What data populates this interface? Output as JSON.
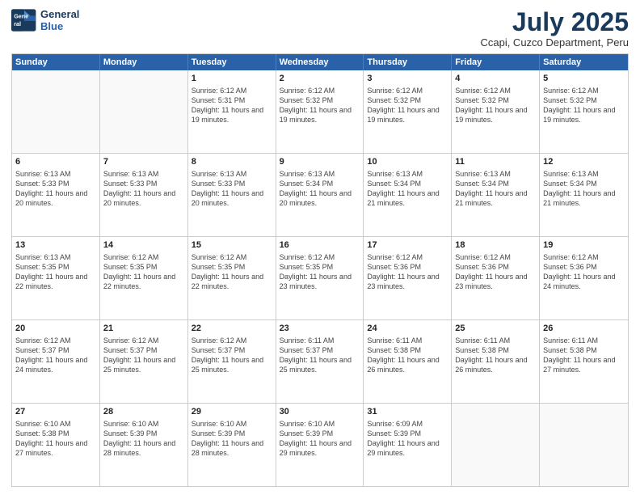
{
  "header": {
    "logo_line1": "General",
    "logo_line2": "Blue",
    "main_title": "July 2025",
    "subtitle": "Ccapi, Cuzco Department, Peru"
  },
  "weekdays": [
    "Sunday",
    "Monday",
    "Tuesday",
    "Wednesday",
    "Thursday",
    "Friday",
    "Saturday"
  ],
  "weeks": [
    [
      {
        "day": "",
        "info": ""
      },
      {
        "day": "",
        "info": ""
      },
      {
        "day": "1",
        "info": "Sunrise: 6:12 AM\nSunset: 5:31 PM\nDaylight: 11 hours and 19 minutes."
      },
      {
        "day": "2",
        "info": "Sunrise: 6:12 AM\nSunset: 5:32 PM\nDaylight: 11 hours and 19 minutes."
      },
      {
        "day": "3",
        "info": "Sunrise: 6:12 AM\nSunset: 5:32 PM\nDaylight: 11 hours and 19 minutes."
      },
      {
        "day": "4",
        "info": "Sunrise: 6:12 AM\nSunset: 5:32 PM\nDaylight: 11 hours and 19 minutes."
      },
      {
        "day": "5",
        "info": "Sunrise: 6:12 AM\nSunset: 5:32 PM\nDaylight: 11 hours and 19 minutes."
      }
    ],
    [
      {
        "day": "6",
        "info": "Sunrise: 6:13 AM\nSunset: 5:33 PM\nDaylight: 11 hours and 20 minutes."
      },
      {
        "day": "7",
        "info": "Sunrise: 6:13 AM\nSunset: 5:33 PM\nDaylight: 11 hours and 20 minutes."
      },
      {
        "day": "8",
        "info": "Sunrise: 6:13 AM\nSunset: 5:33 PM\nDaylight: 11 hours and 20 minutes."
      },
      {
        "day": "9",
        "info": "Sunrise: 6:13 AM\nSunset: 5:34 PM\nDaylight: 11 hours and 20 minutes."
      },
      {
        "day": "10",
        "info": "Sunrise: 6:13 AM\nSunset: 5:34 PM\nDaylight: 11 hours and 21 minutes."
      },
      {
        "day": "11",
        "info": "Sunrise: 6:13 AM\nSunset: 5:34 PM\nDaylight: 11 hours and 21 minutes."
      },
      {
        "day": "12",
        "info": "Sunrise: 6:13 AM\nSunset: 5:34 PM\nDaylight: 11 hours and 21 minutes."
      }
    ],
    [
      {
        "day": "13",
        "info": "Sunrise: 6:13 AM\nSunset: 5:35 PM\nDaylight: 11 hours and 22 minutes."
      },
      {
        "day": "14",
        "info": "Sunrise: 6:12 AM\nSunset: 5:35 PM\nDaylight: 11 hours and 22 minutes."
      },
      {
        "day": "15",
        "info": "Sunrise: 6:12 AM\nSunset: 5:35 PM\nDaylight: 11 hours and 22 minutes."
      },
      {
        "day": "16",
        "info": "Sunrise: 6:12 AM\nSunset: 5:35 PM\nDaylight: 11 hours and 23 minutes."
      },
      {
        "day": "17",
        "info": "Sunrise: 6:12 AM\nSunset: 5:36 PM\nDaylight: 11 hours and 23 minutes."
      },
      {
        "day": "18",
        "info": "Sunrise: 6:12 AM\nSunset: 5:36 PM\nDaylight: 11 hours and 23 minutes."
      },
      {
        "day": "19",
        "info": "Sunrise: 6:12 AM\nSunset: 5:36 PM\nDaylight: 11 hours and 24 minutes."
      }
    ],
    [
      {
        "day": "20",
        "info": "Sunrise: 6:12 AM\nSunset: 5:37 PM\nDaylight: 11 hours and 24 minutes."
      },
      {
        "day": "21",
        "info": "Sunrise: 6:12 AM\nSunset: 5:37 PM\nDaylight: 11 hours and 25 minutes."
      },
      {
        "day": "22",
        "info": "Sunrise: 6:12 AM\nSunset: 5:37 PM\nDaylight: 11 hours and 25 minutes."
      },
      {
        "day": "23",
        "info": "Sunrise: 6:11 AM\nSunset: 5:37 PM\nDaylight: 11 hours and 25 minutes."
      },
      {
        "day": "24",
        "info": "Sunrise: 6:11 AM\nSunset: 5:38 PM\nDaylight: 11 hours and 26 minutes."
      },
      {
        "day": "25",
        "info": "Sunrise: 6:11 AM\nSunset: 5:38 PM\nDaylight: 11 hours and 26 minutes."
      },
      {
        "day": "26",
        "info": "Sunrise: 6:11 AM\nSunset: 5:38 PM\nDaylight: 11 hours and 27 minutes."
      }
    ],
    [
      {
        "day": "27",
        "info": "Sunrise: 6:10 AM\nSunset: 5:38 PM\nDaylight: 11 hours and 27 minutes."
      },
      {
        "day": "28",
        "info": "Sunrise: 6:10 AM\nSunset: 5:39 PM\nDaylight: 11 hours and 28 minutes."
      },
      {
        "day": "29",
        "info": "Sunrise: 6:10 AM\nSunset: 5:39 PM\nDaylight: 11 hours and 28 minutes."
      },
      {
        "day": "30",
        "info": "Sunrise: 6:10 AM\nSunset: 5:39 PM\nDaylight: 11 hours and 29 minutes."
      },
      {
        "day": "31",
        "info": "Sunrise: 6:09 AM\nSunset: 5:39 PM\nDaylight: 11 hours and 29 minutes."
      },
      {
        "day": "",
        "info": ""
      },
      {
        "day": "",
        "info": ""
      }
    ]
  ]
}
